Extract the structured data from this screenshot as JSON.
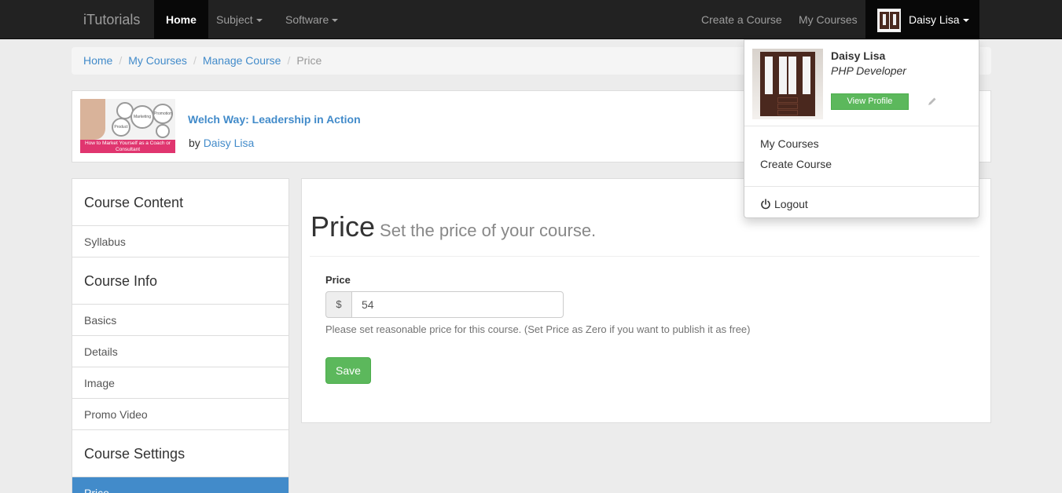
{
  "navbar": {
    "brand": "iTutorials",
    "home": "Home",
    "subject": "Subject",
    "software": "Software",
    "create_course": "Create a Course",
    "my_courses": "My Courses",
    "user": "Daisy Lisa"
  },
  "breadcrumb": [
    "Home",
    "My Courses",
    "Manage Course",
    "Price"
  ],
  "course": {
    "title": "Welch Way: Leadership in Action",
    "by_label": "by",
    "author": "Daisy Lisa",
    "thumb_banner": "How to Market Yourself as a Coach or Consultant",
    "thumb_gears": [
      "Marketing",
      "Product",
      "Promotion"
    ]
  },
  "sidebar": {
    "course_content": "Course Content",
    "syllabus": "Syllabus",
    "course_info": "Course Info",
    "basics": "Basics",
    "details": "Details",
    "image": "Image",
    "promo_video": "Promo Video",
    "course_settings": "Course Settings",
    "price": "Price"
  },
  "main": {
    "title": "Price",
    "subtitle": "Set the price of your course.",
    "price_label": "Price",
    "currency": "$",
    "price_value": "54",
    "help": "Please set reasonable price for this course. (Set Price as Zero if you want to publish it as free)",
    "save": "Save"
  },
  "dropdown": {
    "name": "Daisy Lisa",
    "role": "PHP Developer",
    "view_profile": "View Profile",
    "my_courses": "My Courses",
    "create_course": "Create Course",
    "logout": "Logout"
  },
  "colors": {
    "navbar": "#222222",
    "link": "#428bca",
    "success": "#5cb85c",
    "active": "#428bca"
  }
}
